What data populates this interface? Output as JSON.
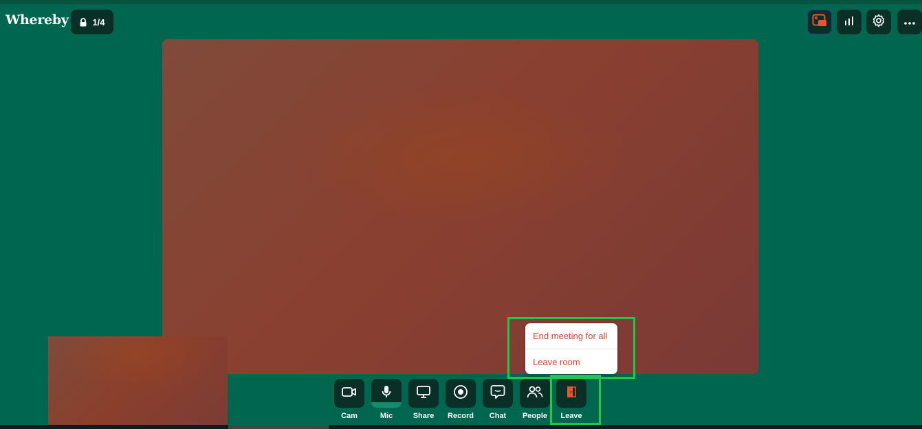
{
  "app": {
    "logo": "Whereby",
    "lock_chip": "1/4",
    "lock_icon": "lock-icon"
  },
  "top_right": [
    {
      "name": "layout-toggle-button",
      "icon": "picture-in-picture-icon",
      "active": true
    },
    {
      "name": "stats-button",
      "icon": "bar-chart-icon"
    },
    {
      "name": "settings-button",
      "icon": "gear-icon"
    },
    {
      "name": "more-button",
      "icon": "more-horizontal-icon"
    }
  ],
  "controls": [
    {
      "key": "cam",
      "label": "Cam",
      "icon": "camera-icon"
    },
    {
      "key": "mic",
      "label": "Mic",
      "icon": "microphone-icon"
    },
    {
      "key": "share",
      "label": "Share",
      "icon": "screen-share-icon"
    },
    {
      "key": "record",
      "label": "Record",
      "icon": "record-icon"
    },
    {
      "key": "chat",
      "label": "Chat",
      "icon": "chat-icon"
    },
    {
      "key": "people",
      "label": "People",
      "icon": "people-icon"
    },
    {
      "key": "leave",
      "label": "Leave",
      "icon": "door-exit-icon"
    }
  ],
  "leave_menu": {
    "items": [
      "End meeting for all",
      "Leave room"
    ]
  },
  "colors": {
    "background": "#00664f",
    "button": "#0a2f26",
    "leave_accent": "#e8552f",
    "highlight": "#1ec84a",
    "menu_text": "#d1482a"
  }
}
